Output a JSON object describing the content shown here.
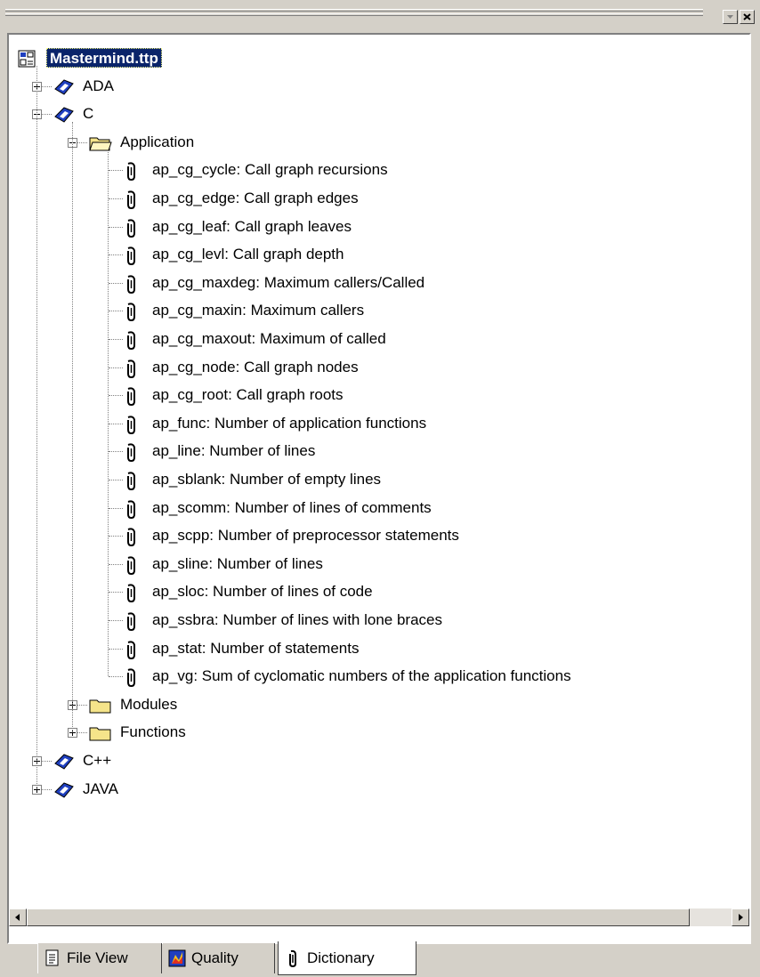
{
  "window": {
    "minimize_glyph": "▼",
    "close_glyph": "×"
  },
  "tree": {
    "root": {
      "label": "Mastermind.ttp",
      "icon": "project-icon"
    },
    "languages": [
      {
        "label": "ADA",
        "expanded": false
      },
      {
        "label": "C",
        "expanded": true
      },
      {
        "label": "C++",
        "expanded": false
      },
      {
        "label": "JAVA",
        "expanded": false
      }
    ],
    "c_children": {
      "application": {
        "label": "Application",
        "items": [
          "ap_cg_cycle: Call graph recursions",
          "ap_cg_edge: Call graph edges",
          "ap_cg_leaf: Call graph leaves",
          "ap_cg_levl: Call graph depth",
          "ap_cg_maxdeg: Maximum callers/Called",
          "ap_cg_maxin: Maximum callers",
          "ap_cg_maxout: Maximum of called",
          "ap_cg_node: Call graph nodes",
          "ap_cg_root: Call graph roots",
          "ap_func: Number of application functions",
          "ap_line: Number of lines",
          "ap_sblank: Number of empty lines",
          "ap_scomm: Number of lines of comments",
          "ap_scpp: Number of preprocessor statements",
          "ap_sline: Number of lines",
          "ap_sloc: Number of lines of code",
          "ap_ssbra: Number of lines with lone braces",
          "ap_stat: Number of statements",
          "ap_vg: Sum of cyclomatic numbers of the application functions"
        ]
      },
      "modules": {
        "label": "Modules"
      },
      "functions": {
        "label": "Functions"
      }
    }
  },
  "tabs": [
    {
      "label": "File View",
      "icon": "document-icon",
      "active": false
    },
    {
      "label": "Quality",
      "icon": "quality-icon",
      "active": false
    },
    {
      "label": "Dictionary",
      "icon": "dictionary-icon",
      "active": true
    }
  ],
  "colors": {
    "selection": "#0a246a",
    "language_icon": "#1f3fbf",
    "folder": "#f5e48a"
  }
}
